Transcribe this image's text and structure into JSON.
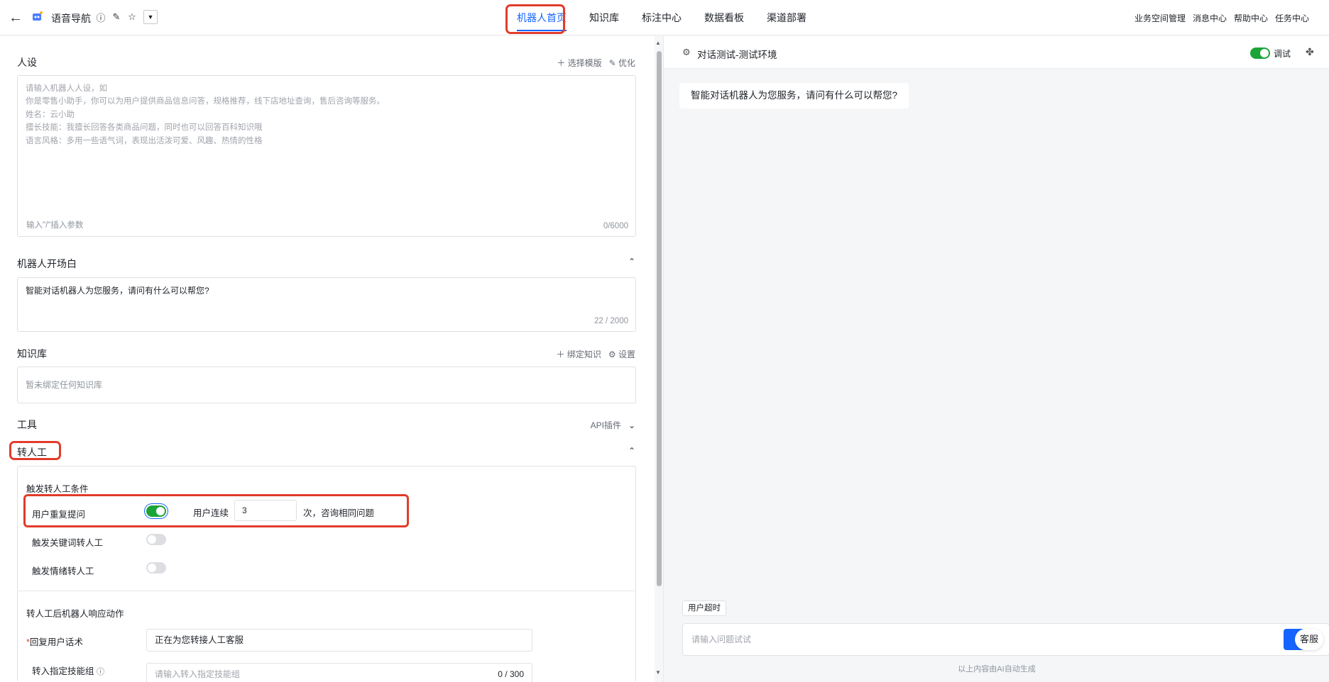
{
  "header": {
    "bot_name": "语音导航",
    "nav_tabs": [
      "机器人首页",
      "知识库",
      "标注中心",
      "数据看板",
      "渠道部署"
    ],
    "right_links": [
      "业务空间管理",
      "消息中心",
      "帮助中心",
      "任务中心"
    ]
  },
  "persona": {
    "title": "人设",
    "select_template": "选择模版",
    "optimize": "优化",
    "placeholder": "请输入机器人人设，如\n你是零售小助手，你可以为用户提供商品信息问答，规格推荐，线下店地址查询，售后咨询等服务。\n姓名：云小助\n擅长技能：我擅长回答各类商品问题，同时也可以回答百科知识哦\n语言风格：多用一些语气词，表现出活泼可爱、风趣、热情的性格",
    "hint": "输入\"/\"插入参数",
    "counter": "0/6000"
  },
  "opening": {
    "title": "机器人开场白",
    "text": "智能对话机器人为您服务，请问有什么可以帮您?",
    "counter": "22 / 2000"
  },
  "knowledge": {
    "title": "知识库",
    "bind": "绑定知识",
    "settings": "设置",
    "empty": "暂未绑定任何知识库"
  },
  "tools": {
    "title": "工具",
    "plugin": "API插件"
  },
  "transfer": {
    "title": "转人工",
    "conditions_title": "触发转人工条件",
    "repeat_label": "用户重复提问",
    "repeat_on": true,
    "consecutive_prefix": "用户连续",
    "repeat_count": "3",
    "consecutive_suffix": "次，咨询相同问题",
    "keyword_label": "触发关键词转人工",
    "keyword_on": false,
    "emotion_label": "触发情绪转人工",
    "emotion_on": false,
    "action_title": "转人工后机器人响应动作",
    "reply_label": "回复用户话术",
    "reply_value": "正在为您转接人工客服",
    "skill_label": "转入指定技能组",
    "skill_placeholder": "请输入转入指定技能组",
    "skill_counter": "0 / 300"
  },
  "chat": {
    "title": "对话测试-测试环境",
    "debug_label": "调试",
    "debug_on": true,
    "greeting": "智能对话机器人为您服务，请问有什么可以帮您?",
    "timeout_tag": "用户超时",
    "input_placeholder": "请输入问题试试",
    "kefu": "客服",
    "footer": "以上内容由AI自动生成"
  },
  "colors": {
    "accent": "#1664ff",
    "toggle_on": "#1ba538",
    "highlight": "#e13c2b"
  }
}
